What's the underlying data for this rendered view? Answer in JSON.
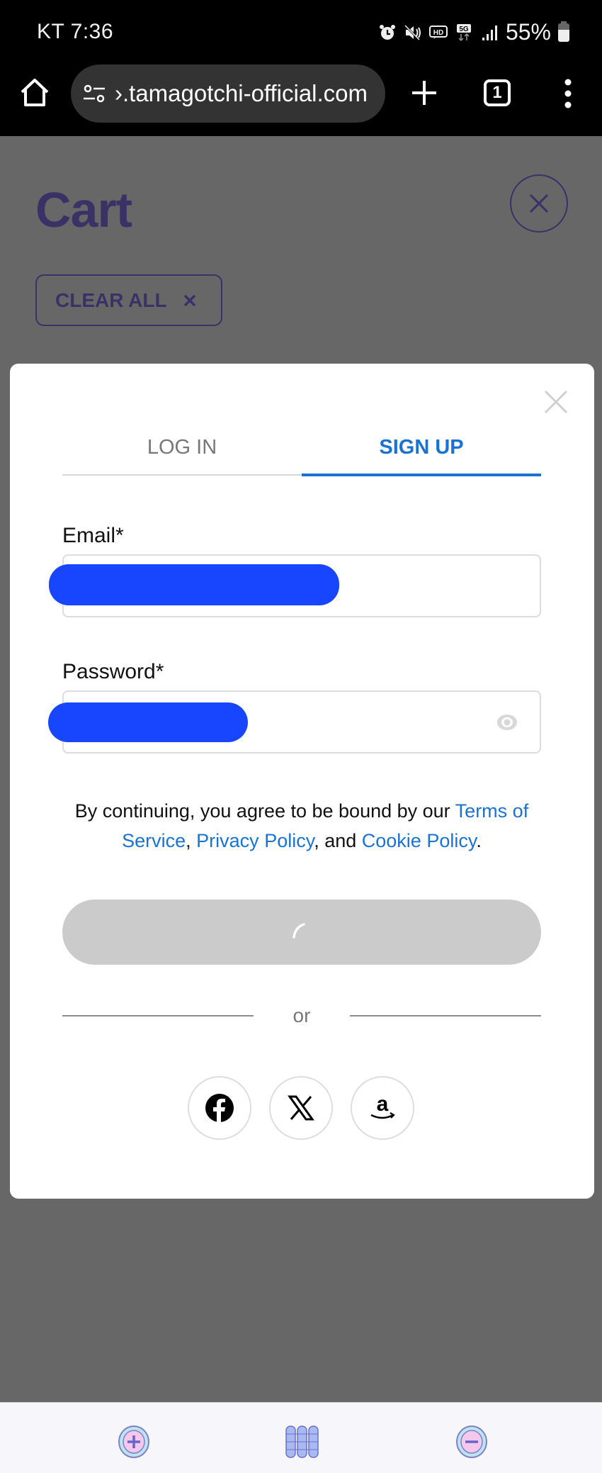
{
  "status_bar": {
    "time": "KT 7:36",
    "icons": [
      "alarm-icon",
      "mute-icon",
      "hd-voice-icon",
      "5g-icon",
      "signal-icon"
    ],
    "battery_percent": "55%"
  },
  "browser": {
    "url": "›.tamagotchi-official.com",
    "tab_count": "1"
  },
  "page": {
    "title": "Cart",
    "clear_all_label": "CLEAR ALL"
  },
  "modal": {
    "tabs": [
      {
        "label": "LOG IN",
        "active": false
      },
      {
        "label": "SIGN UP",
        "active": true
      }
    ],
    "email": {
      "label": "Email*",
      "value": "[redacted]"
    },
    "password": {
      "label": "Password*",
      "value": "[redacted]"
    },
    "terms": {
      "prefix": "By continuing, you agree to be bound by our ",
      "terms_link": "Terms of Service",
      "sep1": ", ",
      "privacy_link": "Privacy Policy",
      "sep2": ", and ",
      "cookie_link": "Cookie Policy",
      "suffix": "."
    },
    "submit_state": "loading",
    "divider_text": "or",
    "social_logins": [
      "facebook",
      "x",
      "amazon"
    ]
  },
  "bottom_bar": {
    "buttons": [
      "zoom-in",
      "tabs-overview",
      "zoom-out"
    ]
  },
  "colors": {
    "accent_blue": "#1a73d2",
    "brand_purple": "#3a3266",
    "redaction": "#1846ff"
  }
}
